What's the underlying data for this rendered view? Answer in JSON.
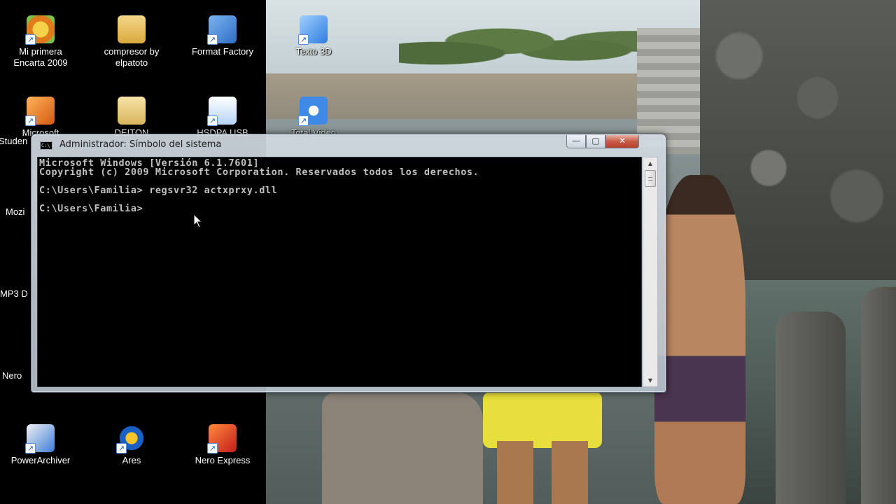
{
  "desktop": {
    "icons": [
      {
        "label_line1": "Mi primera",
        "label_line2": "Encarta 2009",
        "icon": "encarta-icon"
      },
      {
        "label_line1": "compresor by",
        "label_line2": "elpatoto",
        "icon": "folder-icon"
      },
      {
        "label_line1": "Format Factory",
        "label_line2": "",
        "icon": "format-factory-icon"
      },
      {
        "label_line1": "Texto 3D",
        "label_line2": "",
        "icon": "texto-3d-icon"
      },
      {
        "label_line1": "Microsoft",
        "label_line2": "Studen",
        "icon": "microsoft-office-icon"
      },
      {
        "label_line1": "DEITON",
        "label_line2": "",
        "icon": "folder-icon"
      },
      {
        "label_line1": "HSDPA USB",
        "label_line2": "",
        "icon": "hsdpa-usb-icon"
      },
      {
        "label_line1": "Total Video",
        "label_line2": "",
        "icon": "total-video-icon"
      },
      {
        "label_line1": "PowerArchiver",
        "label_line2": "",
        "icon": "powerarchiver-icon"
      },
      {
        "label_line1": "Ares",
        "label_line2": "",
        "icon": "ares-icon"
      },
      {
        "label_line1": "Nero Express",
        "label_line2": "",
        "icon": "nero-express-icon"
      }
    ],
    "partial_labels": [
      "Mozi",
      "MP3 D",
      "Nero"
    ],
    "shortcut_arrow": "↗"
  },
  "window": {
    "title": "Administrador: Símbolo del sistema",
    "title_icon_text": "C:\\",
    "min_label": "—",
    "max_label": "▢",
    "close_label": "✕",
    "console_lines": [
      "Microsoft Windows [Versión 6.1.7601]",
      "Copyright (c) 2009 Microsoft Corporation. Reservados todos los derechos.",
      "",
      "C:\\Users\\Familia> regsvr32 actxprxy.dll",
      "",
      "C:\\Users\\Familia>"
    ],
    "scroll_up": "▲",
    "scroll_down": "▼"
  }
}
